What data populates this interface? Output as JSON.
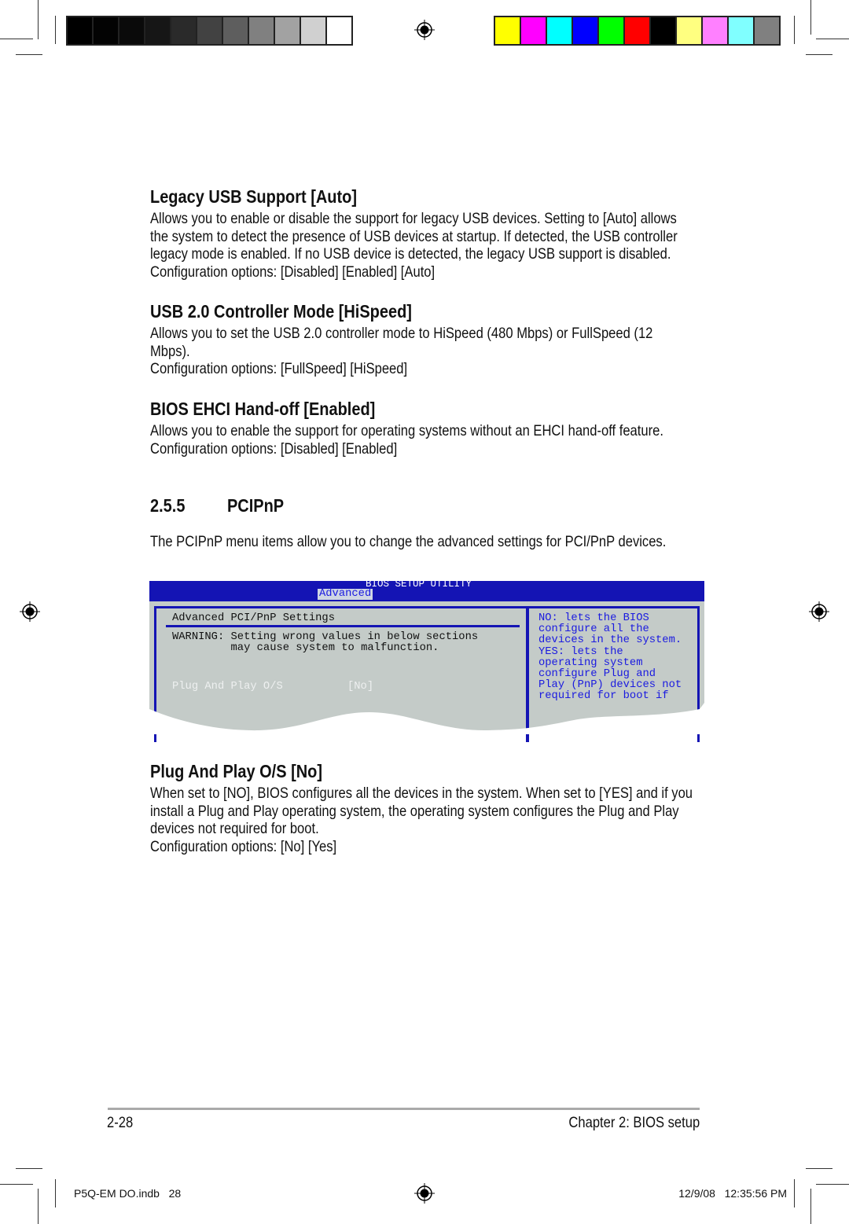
{
  "color_bars": {
    "gray": [
      "#000000",
      "#030303",
      "#0a0a0a",
      "#161616",
      "#2a2a2a",
      "#424242",
      "#5e5e5e",
      "#808080",
      "#a2a2a2",
      "#d0d0d0",
      "#ffffff"
    ],
    "color": [
      "#ffff00",
      "#ff00ff",
      "#00ffff",
      "#0000ff",
      "#00ff00",
      "#ff0000",
      "#000000",
      "#ffff80",
      "#ff80ff",
      "#80ffff",
      "#808080"
    ]
  },
  "sections": [
    {
      "title": "Legacy USB Support [Auto]",
      "body": [
        "Allows you to enable or disable the support for legacy USB devices. Setting to [Auto] allows the system to detect the presence of USB devices at startup. If detected, the USB controller legacy mode is enabled. If no USB device is detected, the legacy USB support is disabled.",
        "Configuration options: [Disabled] [Enabled] [Auto]"
      ]
    },
    {
      "title": "USB 2.0 Controller Mode [HiSpeed]",
      "body": [
        "Allows you to set the USB 2.0 controller mode to HiSpeed (480 Mbps) or FullSpeed (12 Mbps).",
        "Configuration options: [FullSpeed] [HiSpeed]"
      ]
    },
    {
      "title": "BIOS EHCI Hand-off [Enabled]",
      "body": [
        "Allows you to enable the support for operating systems without an EHCI hand-off feature.",
        "Configuration options: [Disabled] [Enabled]"
      ]
    }
  ],
  "subsection": {
    "number": "2.5.5",
    "title": "PCIPnP",
    "intro": "The PCIPnP menu items allow you to change the advanced settings for PCI/PnP devices."
  },
  "bios": {
    "title": "BIOS SETUP UTILITY",
    "tab": "Advanced",
    "panel_title": "Advanced PCI/PnP Settings",
    "warning": "WARNING: Setting wrong values in below sections\n         may cause system to malfunction.",
    "item_label": "Plug And Play O/S",
    "item_value": "[No]",
    "help": "NO: lets the BIOS\nconfigure all the\ndevices in the system.\nYES: lets the\noperating system\nconfigure Plug and\nPlay (PnP) devices not\nrequired for boot if",
    "colors": {
      "blue": "#1414b4",
      "panel": "#c4cbc8",
      "help_text": "#1a1ae0"
    }
  },
  "plug": {
    "title": "Plug And Play O/S [No]",
    "body": [
      "When set to [NO], BIOS configures all the devices in the system. When set to [YES] and if you install a Plug and Play operating system, the operating system configures the Plug and Play devices not required for boot.",
      "Configuration options: [No] [Yes]"
    ]
  },
  "footer": {
    "page": "2-28",
    "chapter": "Chapter 2: BIOS setup"
  },
  "slug": {
    "file": "P5Q-EM DO.indb   28",
    "date": "12/9/08   12:35:56 PM"
  }
}
